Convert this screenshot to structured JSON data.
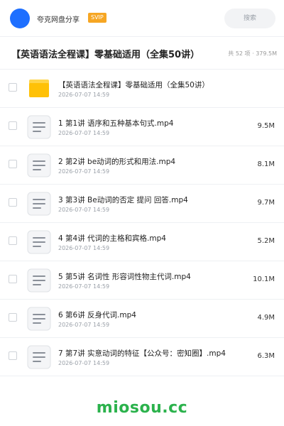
{
  "header": {
    "user_name": "夸克网盘分享",
    "badge": "SVIP",
    "search_placeholder": "搜索"
  },
  "folder": {
    "title": "【英语语法全程课】零基础适用（全集50讲）",
    "meta": "共 52 项 · 379.5M"
  },
  "files": [
    {
      "type": "folder",
      "name": "【英语语法全程课】零基础适用（全集50讲）",
      "date": "2026-07-07 14:59",
      "size": ""
    },
    {
      "type": "video",
      "name": "1 第1讲 语序和五种基本句式.mp4",
      "date": "2026-07-07 14:59",
      "size": "9.5M"
    },
    {
      "type": "video",
      "name": "2 第2讲 be动词的形式和用法.mp4",
      "date": "2026-07-07 14:59",
      "size": "8.1M"
    },
    {
      "type": "video",
      "name": "3 第3讲 Be动词的否定 提问 回答.mp4",
      "date": "2026-07-07 14:59",
      "size": "9.7M"
    },
    {
      "type": "video",
      "name": "4 第4讲 代词的主格和宾格.mp4",
      "date": "2026-07-07 14:59",
      "size": "5.2M"
    },
    {
      "type": "video",
      "name": "5 第5讲 名词性 形容词性物主代词.mp4",
      "date": "2026-07-07 14:59",
      "size": "10.1M"
    },
    {
      "type": "video",
      "name": "6 第6讲 反身代词.mp4",
      "date": "2026-07-07 14:59",
      "size": "4.9M"
    },
    {
      "type": "video",
      "name": "7 第7讲 实意动词的特征【公众号：密知圈】.mp4",
      "date": "2026-07-07 14:59",
      "size": "6.3M"
    }
  ],
  "watermark": "miosou.cc",
  "colors": {
    "accent": "#1e6fff",
    "badge": "#f6a623",
    "folder": "#ffc107",
    "watermark": "#2bb24c"
  }
}
